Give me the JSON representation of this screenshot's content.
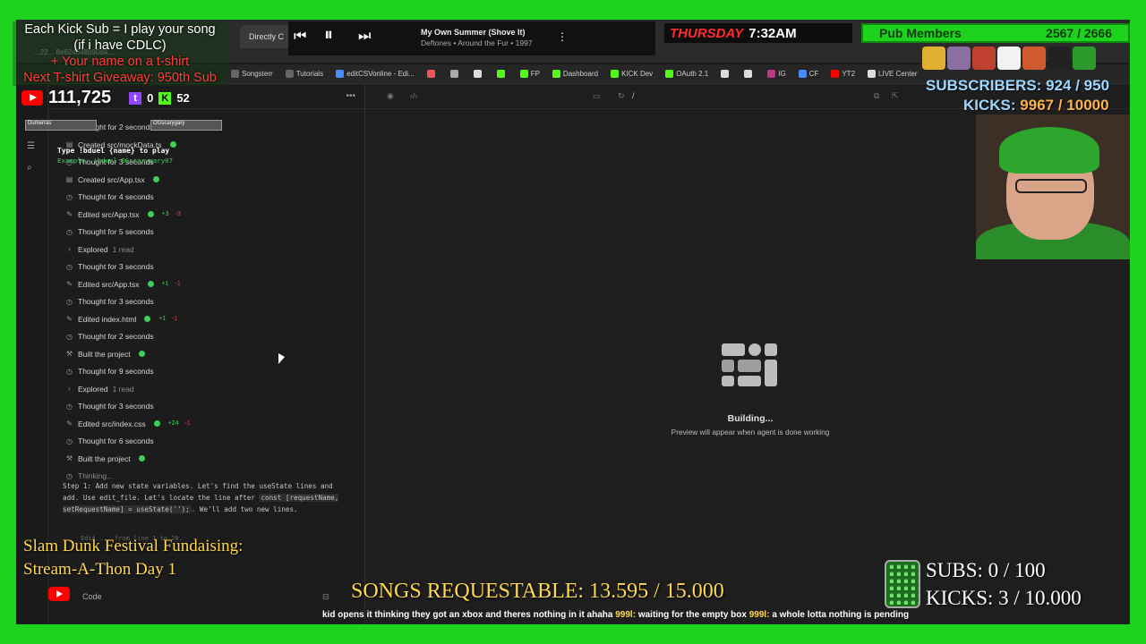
{
  "browser": {
    "tab_title": "Directly C",
    "url_fragment": "...22... 8e624648b90d4...",
    "bookmarks": [
      {
        "label": "Songsterr",
        "color": "#666"
      },
      {
        "label": "Tutorials",
        "color": "#666"
      },
      {
        "label": "editCSVonline - Edi...",
        "color": "#4a8cff"
      },
      {
        "label": "",
        "color": "#e55"
      },
      {
        "label": "",
        "color": "#aaa"
      },
      {
        "label": "",
        "color": "#ddd"
      },
      {
        "label": "",
        "color": "#53fc18"
      },
      {
        "label": "FP",
        "color": "#53fc18"
      },
      {
        "label": "Dashboard",
        "color": "#53fc18"
      },
      {
        "label": "KICK Dev",
        "color": "#53fc18"
      },
      {
        "label": "OAuth 2.1",
        "color": "#53fc18"
      },
      {
        "label": "",
        "color": "#ddd"
      },
      {
        "label": "",
        "color": "#ddd"
      },
      {
        "label": "IG",
        "color": "#c13584"
      },
      {
        "label": "CF",
        "color": "#4a8cff"
      },
      {
        "label": "YT2",
        "color": "#ff0000"
      },
      {
        "label": "LIVE Center",
        "color": "#ddd"
      }
    ]
  },
  "chat": {
    "steps": [
      {
        "text": "Thought for 2 seconds",
        "icon": "clock-icon"
      },
      {
        "text": "Created src/mockData.ts",
        "icon": "file-icon",
        "ok": true
      },
      {
        "text": "Thought for 3 seconds",
        "icon": "clock-icon"
      },
      {
        "text": "Created src/App.tsx",
        "icon": "file-icon",
        "ok": true
      },
      {
        "text": "Thought for 4 seconds",
        "icon": "clock-icon"
      },
      {
        "text": "Edited src/App.tsx",
        "icon": "pencil-icon",
        "ok": true,
        "add": "+3",
        "del": "-3"
      },
      {
        "text": "Thought for 5 seconds",
        "icon": "clock-icon"
      },
      {
        "text": "Explored",
        "extra": "1 read",
        "icon": "chevron-right-icon"
      },
      {
        "text": "Thought for 3 seconds",
        "icon": "clock-icon"
      },
      {
        "text": "Edited src/App.tsx",
        "icon": "pencil-icon",
        "ok": true,
        "add": "+1",
        "del": "-1"
      },
      {
        "text": "Thought for 3 seconds",
        "icon": "clock-icon"
      },
      {
        "text": "Edited index.html",
        "icon": "pencil-icon",
        "ok": true,
        "add": "+1",
        "del": "-1"
      },
      {
        "text": "Thought for 2 seconds",
        "icon": "clock-icon"
      },
      {
        "text": "Built the project",
        "icon": "hammer-icon",
        "ok": true
      },
      {
        "text": "Thought for 9 seconds",
        "icon": "clock-icon"
      },
      {
        "text": "Explored",
        "extra": "1 read",
        "icon": "chevron-right-icon"
      },
      {
        "text": "Thought for 3 seconds",
        "icon": "clock-icon"
      },
      {
        "text": "Edited src/index.css",
        "icon": "pencil-icon",
        "ok": true,
        "add": "+24",
        "del": "-1"
      },
      {
        "text": "Thought for 6 seconds",
        "icon": "clock-icon"
      },
      {
        "text": "Built the project",
        "icon": "hammer-icon",
        "ok": true
      },
      {
        "text": "Thinking...",
        "icon": "clock-icon",
        "dim": true
      }
    ],
    "thinking_body_1": "Step 1: Add new state variables. Let's find the useState lines and add. Use edit_file. Let's locate the line after",
    "thinking_code": "const [requestName, setRequestName] = useState('');",
    "thinking_body_2": ". We'll add two new lines.",
    "thinking_tail": "Edit ... from line 1 to 20.",
    "composer_label": "Code"
  },
  "preview": {
    "path": "/",
    "building_title": "Building...",
    "building_sub": "Preview will appear when agent is done working"
  },
  "overlay": {
    "kick_sub_line1": "Each Kick Sub = I play your song",
    "kick_sub_line2": "(if i have CDLC)",
    "kick_sub_line3": "+ Your name on a t-shirt",
    "kick_sub_line4": "Next T-shirt Giveaway: 950th Sub",
    "yt_subs": "111,725",
    "twitch_count": "0",
    "kick_count": "52",
    "song_title": "My Own Summer (Shove It)",
    "song_artist": "Deftones • Around the Fur • 1997",
    "day": "THURSDAY",
    "time": "7:32AM",
    "pub_label": "Pub Members",
    "pub_count": "2567 / 2666",
    "subscribers_label": "SUBSCRIBERS:",
    "subscribers_value": "924 / 950",
    "kicks_label": "KICKS:",
    "kicks_value": "9967 / 10000",
    "duel_left": "Dumerras",
    "duel_right": "OGscarygary",
    "duel_instruction": "Type !bduel {name} to play",
    "duel_example": "Example: !bduel OGscarygary07",
    "festival_line1": "Slam Dunk Festival Fundaising:",
    "festival_line2": "Stream-A-Thon Day 1",
    "songs_requestable": "SONGS REQUESTABLE: 13.595 / 15.000",
    "subs_goal": "SUBS:  0 / 100",
    "kicks_goal": "KICKS: 3 / 10.000",
    "ticker_1": "kid opens it thinking they got an xbox and theres nothing in it ahaha",
    "ticker_user_1": "999l:",
    "ticker_2": "waiting for the empty box",
    "ticker_user_2": "999l:",
    "ticker_3": "a whole lotta nothing is pending"
  }
}
